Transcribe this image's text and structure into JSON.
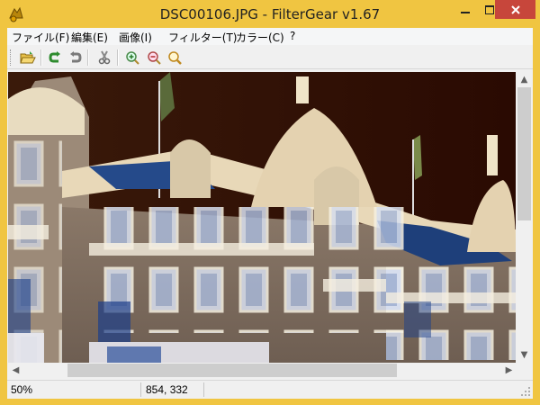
{
  "window": {
    "title": "DSC00106.JPG - FilterGear v1.67"
  },
  "menu": [
    {
      "label": "ファイル(F)"
    },
    {
      "label": "編集(E)"
    },
    {
      "label": "画像(I)"
    },
    {
      "label": "フィルター(T)"
    },
    {
      "label": "カラー(C)"
    },
    {
      "label": "?"
    }
  ],
  "toolbar": {
    "buttons": [
      {
        "icon": "open-folder-icon"
      },
      {
        "icon": "undo-icon"
      },
      {
        "icon": "redo-icon"
      },
      {
        "icon": "cut-icon"
      },
      {
        "icon": "zoom-in-icon"
      },
      {
        "icon": "zoom-out-icon"
      },
      {
        "icon": "magnifier-icon"
      }
    ]
  },
  "status": {
    "zoom": "50%",
    "coords": "854, 332"
  },
  "scroll": {
    "vertical_position": 0.0,
    "horizontal_position": 0.13
  },
  "colors": {
    "frame": "#f0c541",
    "close_button": "#c7463b"
  }
}
